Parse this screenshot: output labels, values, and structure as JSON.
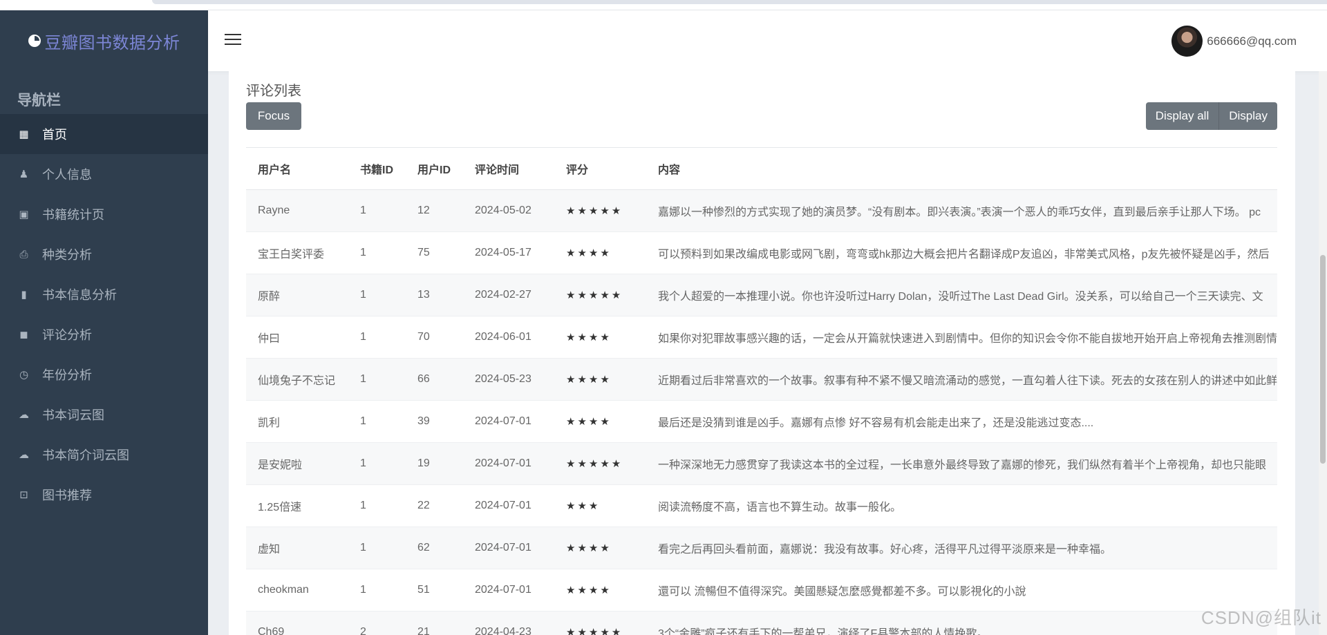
{
  "app": {
    "title": "豆瓣图书数据分析"
  },
  "sidebar": {
    "heading": "导航栏",
    "items": [
      {
        "label": "首页",
        "icon": "dashboard-icon",
        "glyph": "▦",
        "active": true
      },
      {
        "label": "个人信息",
        "icon": "person-icon",
        "glyph": "♟",
        "active": false
      },
      {
        "label": "书籍统计页",
        "icon": "calendar-check-icon",
        "glyph": "▣",
        "active": false
      },
      {
        "label": "种类分析",
        "icon": "printer-icon",
        "glyph": "⎙",
        "active": false
      },
      {
        "label": "书本信息分析",
        "icon": "book-icon",
        "glyph": "▮",
        "active": false
      },
      {
        "label": "评论分析",
        "icon": "comment-icon",
        "glyph": "◼",
        "active": false
      },
      {
        "label": "年份分析",
        "icon": "history-icon",
        "glyph": "◷",
        "active": false
      },
      {
        "label": "书本词云图",
        "icon": "cloud-icon",
        "glyph": "☁",
        "active": false
      },
      {
        "label": "书本简介词云图",
        "icon": "cloud-upload-icon",
        "glyph": "☁",
        "active": false
      },
      {
        "label": "图书推荐",
        "icon": "star-box-icon",
        "glyph": "⊡",
        "active": false
      }
    ]
  },
  "header": {
    "user_email": "666666@qq.com"
  },
  "panel": {
    "title": "评论列表",
    "focus_label": "Focus",
    "display_all_label": "Display all",
    "display_label": "Display"
  },
  "table": {
    "columns": [
      "用户名",
      "书籍ID",
      "用户ID",
      "评论时间",
      "评分",
      "内容"
    ],
    "rows": [
      {
        "user": "Rayne",
        "book_id": "1",
        "user_id": "12",
        "date": "2024-05-02",
        "stars": "★★★★★",
        "content": "嘉娜以一种惨烈的方式实现了她的演员梦。“没有剧本。即兴表演。”表演一个恶人的乖巧女伴，直到最后亲手让那人下场。 pc"
      },
      {
        "user": "宝王白奖评委",
        "book_id": "1",
        "user_id": "75",
        "date": "2024-05-17",
        "stars": "★★★★",
        "content": "可以预料到如果改编成电影或网飞剧，弯弯或hk那边大概会把片名翻译成P友追凶，非常美式风格，p友先被怀疑是凶手，然后"
      },
      {
        "user": "原醉",
        "book_id": "1",
        "user_id": "13",
        "date": "2024-02-27",
        "stars": "★★★★★",
        "content": "我个人超爱的一本推理小说。你也许没听过Harry Dolan，没听过The Last Dead Girl。没关系，可以给自己一个三天读完、文"
      },
      {
        "user": "仲曰",
        "book_id": "1",
        "user_id": "70",
        "date": "2024-06-01",
        "stars": "★★★★",
        "content": "如果你对犯罪故事感兴趣的话，一定会从开篇就快速进入到剧情中。但你的知识会令你不能自拔地开始开启上帝视角去推测剧情"
      },
      {
        "user": "仙境兔子不忘记",
        "book_id": "1",
        "user_id": "66",
        "date": "2024-05-23",
        "stars": "★★★★",
        "content": "近期看过后非常喜欢的一个故事。叙事有种不紧不慢又暗流涌动的感觉，一直勾着人往下读。死去的女孩在别人的讲述中如此鲜"
      },
      {
        "user": "凯利",
        "book_id": "1",
        "user_id": "39",
        "date": "2024-07-01",
        "stars": "★★★★",
        "content": "最后还是没猜到谁是凶手。嘉娜有点惨 好不容易有机会能走出来了，还是没能逃过变态...."
      },
      {
        "user": "是安妮啦",
        "book_id": "1",
        "user_id": "19",
        "date": "2024-07-01",
        "stars": "★★★★★",
        "content": "一种深深地无力感贯穿了我读这本书的全过程，一长串意外最终导致了嘉娜的惨死，我们纵然有着半个上帝视角，却也只能眼"
      },
      {
        "user": "1.25倍速",
        "book_id": "1",
        "user_id": "22",
        "date": "2024-07-01",
        "stars": "★★★",
        "content": "阅读流畅度不高，语言也不算生动。故事一般化。"
      },
      {
        "user": "虚知",
        "book_id": "1",
        "user_id": "62",
        "date": "2024-07-01",
        "stars": "★★★★",
        "content": "看完之后再回头看前面，嘉娜说：我没有故事。好心疼，活得平凡过得平淡原来是一种幸福。"
      },
      {
        "user": "cheokman",
        "book_id": "1",
        "user_id": "51",
        "date": "2024-07-01",
        "stars": "★★★★",
        "content": "還可以 流暢但不值得深究。美國懸疑怎麼感覺都差不多。可以影視化的小說"
      },
      {
        "user": "Ch69",
        "book_id": "2",
        "user_id": "21",
        "date": "2024-04-23",
        "stars": "★★★★★",
        "content": "3个“金雕”疯子还有手下的一帮弟兄，演绎了F县警本部的人情挽歌。"
      }
    ]
  },
  "watermark": "CSDN@组队it"
}
